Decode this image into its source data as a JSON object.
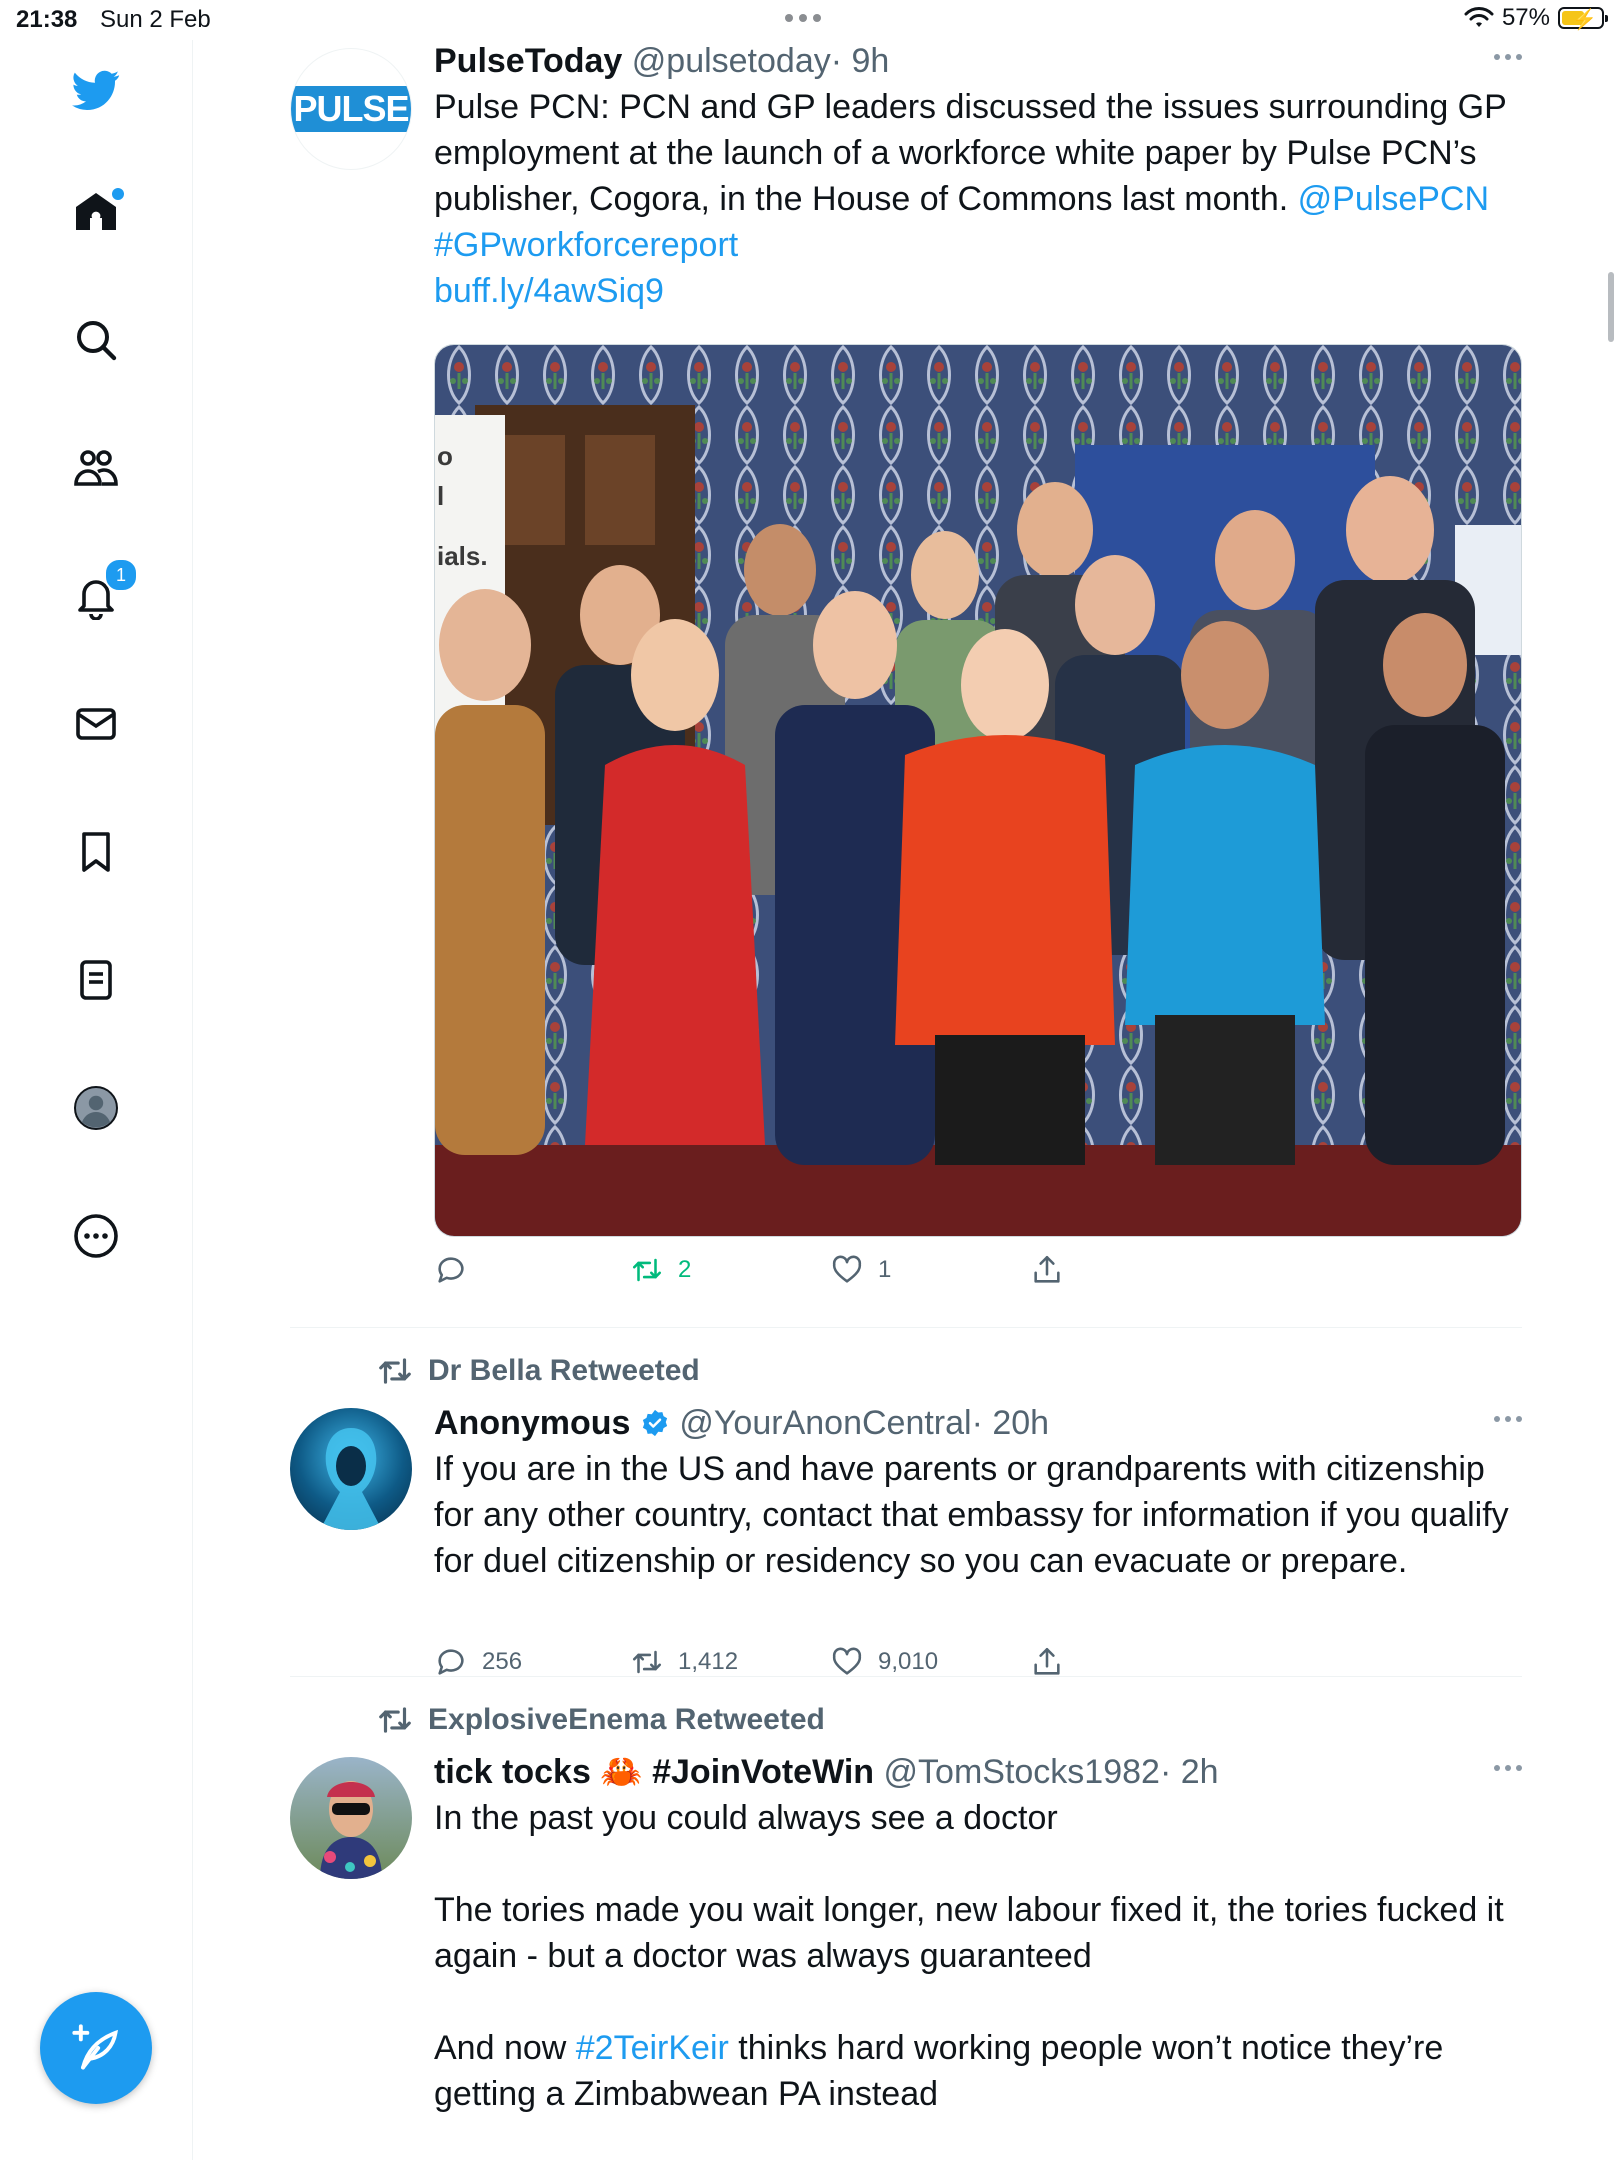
{
  "status_bar": {
    "time": "21:38",
    "date": "Sun 2 Feb",
    "battery_percent": "57%",
    "battery_level": 0.57
  },
  "sidebar": {
    "items": [
      {
        "name": "twitter-logo-icon"
      },
      {
        "name": "home-icon"
      },
      {
        "name": "search-icon"
      },
      {
        "name": "communities-icon"
      },
      {
        "name": "notifications-icon",
        "badge": "1"
      },
      {
        "name": "messages-icon"
      },
      {
        "name": "bookmarks-icon"
      },
      {
        "name": "lists-icon"
      },
      {
        "name": "profile-icon"
      },
      {
        "name": "more-icon"
      }
    ],
    "compose_icon": "compose-tweet-icon"
  },
  "colors": {
    "accent": "#1d9bf0",
    "text": "#0f1419",
    "secondary": "#536471",
    "retweet_green": "#00ba7c",
    "pulse_blue": "#1f8fd6"
  },
  "tweets": [
    {
      "avatar_text": "PULSE",
      "name": "PulseToday",
      "handle": "@pulsetoday",
      "time": "· 9h",
      "text_main": "Pulse PCN: PCN and GP leaders discussed the issues surrounding GP employment at the launch of a workforce white paper by Pulse PCN’s publisher, Cogora, in the House of Commons last month.",
      "mention": "@PulsePCN",
      "hashtag": "#GPworkforcereport",
      "url": "buff.ly/4awSiq9",
      "photo_sign_text": "o\nl\nials.",
      "replies": "",
      "retweets": "2",
      "likes": "1"
    },
    {
      "retweeted_by": "Dr Bella Retweeted",
      "name": "Anonymous",
      "handle": "@YourAnonCentral",
      "time": "· 20h",
      "text": "If you are in the US and have parents or grandparents with citizenship for any other country, contact that embassy for information if you qualify for duel citizenship or residency so you can evacuate or prepare.",
      "replies": "256",
      "retweets": "1,412",
      "likes": "9,010"
    },
    {
      "retweeted_by": "ExplosiveEnema Retweeted",
      "name": "tick tocks",
      "name_emoji": "🦀",
      "name_suffix": "#JoinVoteWin",
      "handle": "@TomStocks1982",
      "time": "· 2h",
      "para1": "In the past you could always see a doctor",
      "para2": "The tories made you wait longer, new labour fixed it, the tories fucked it again - but a doctor was always guaranteed",
      "para3_prefix": "And now ",
      "para3_hashtag": "#2TeirKeir",
      "para3_suffix": " thinks hard working people won’t notice they’re getting a Zimbabwean PA instead"
    }
  ]
}
